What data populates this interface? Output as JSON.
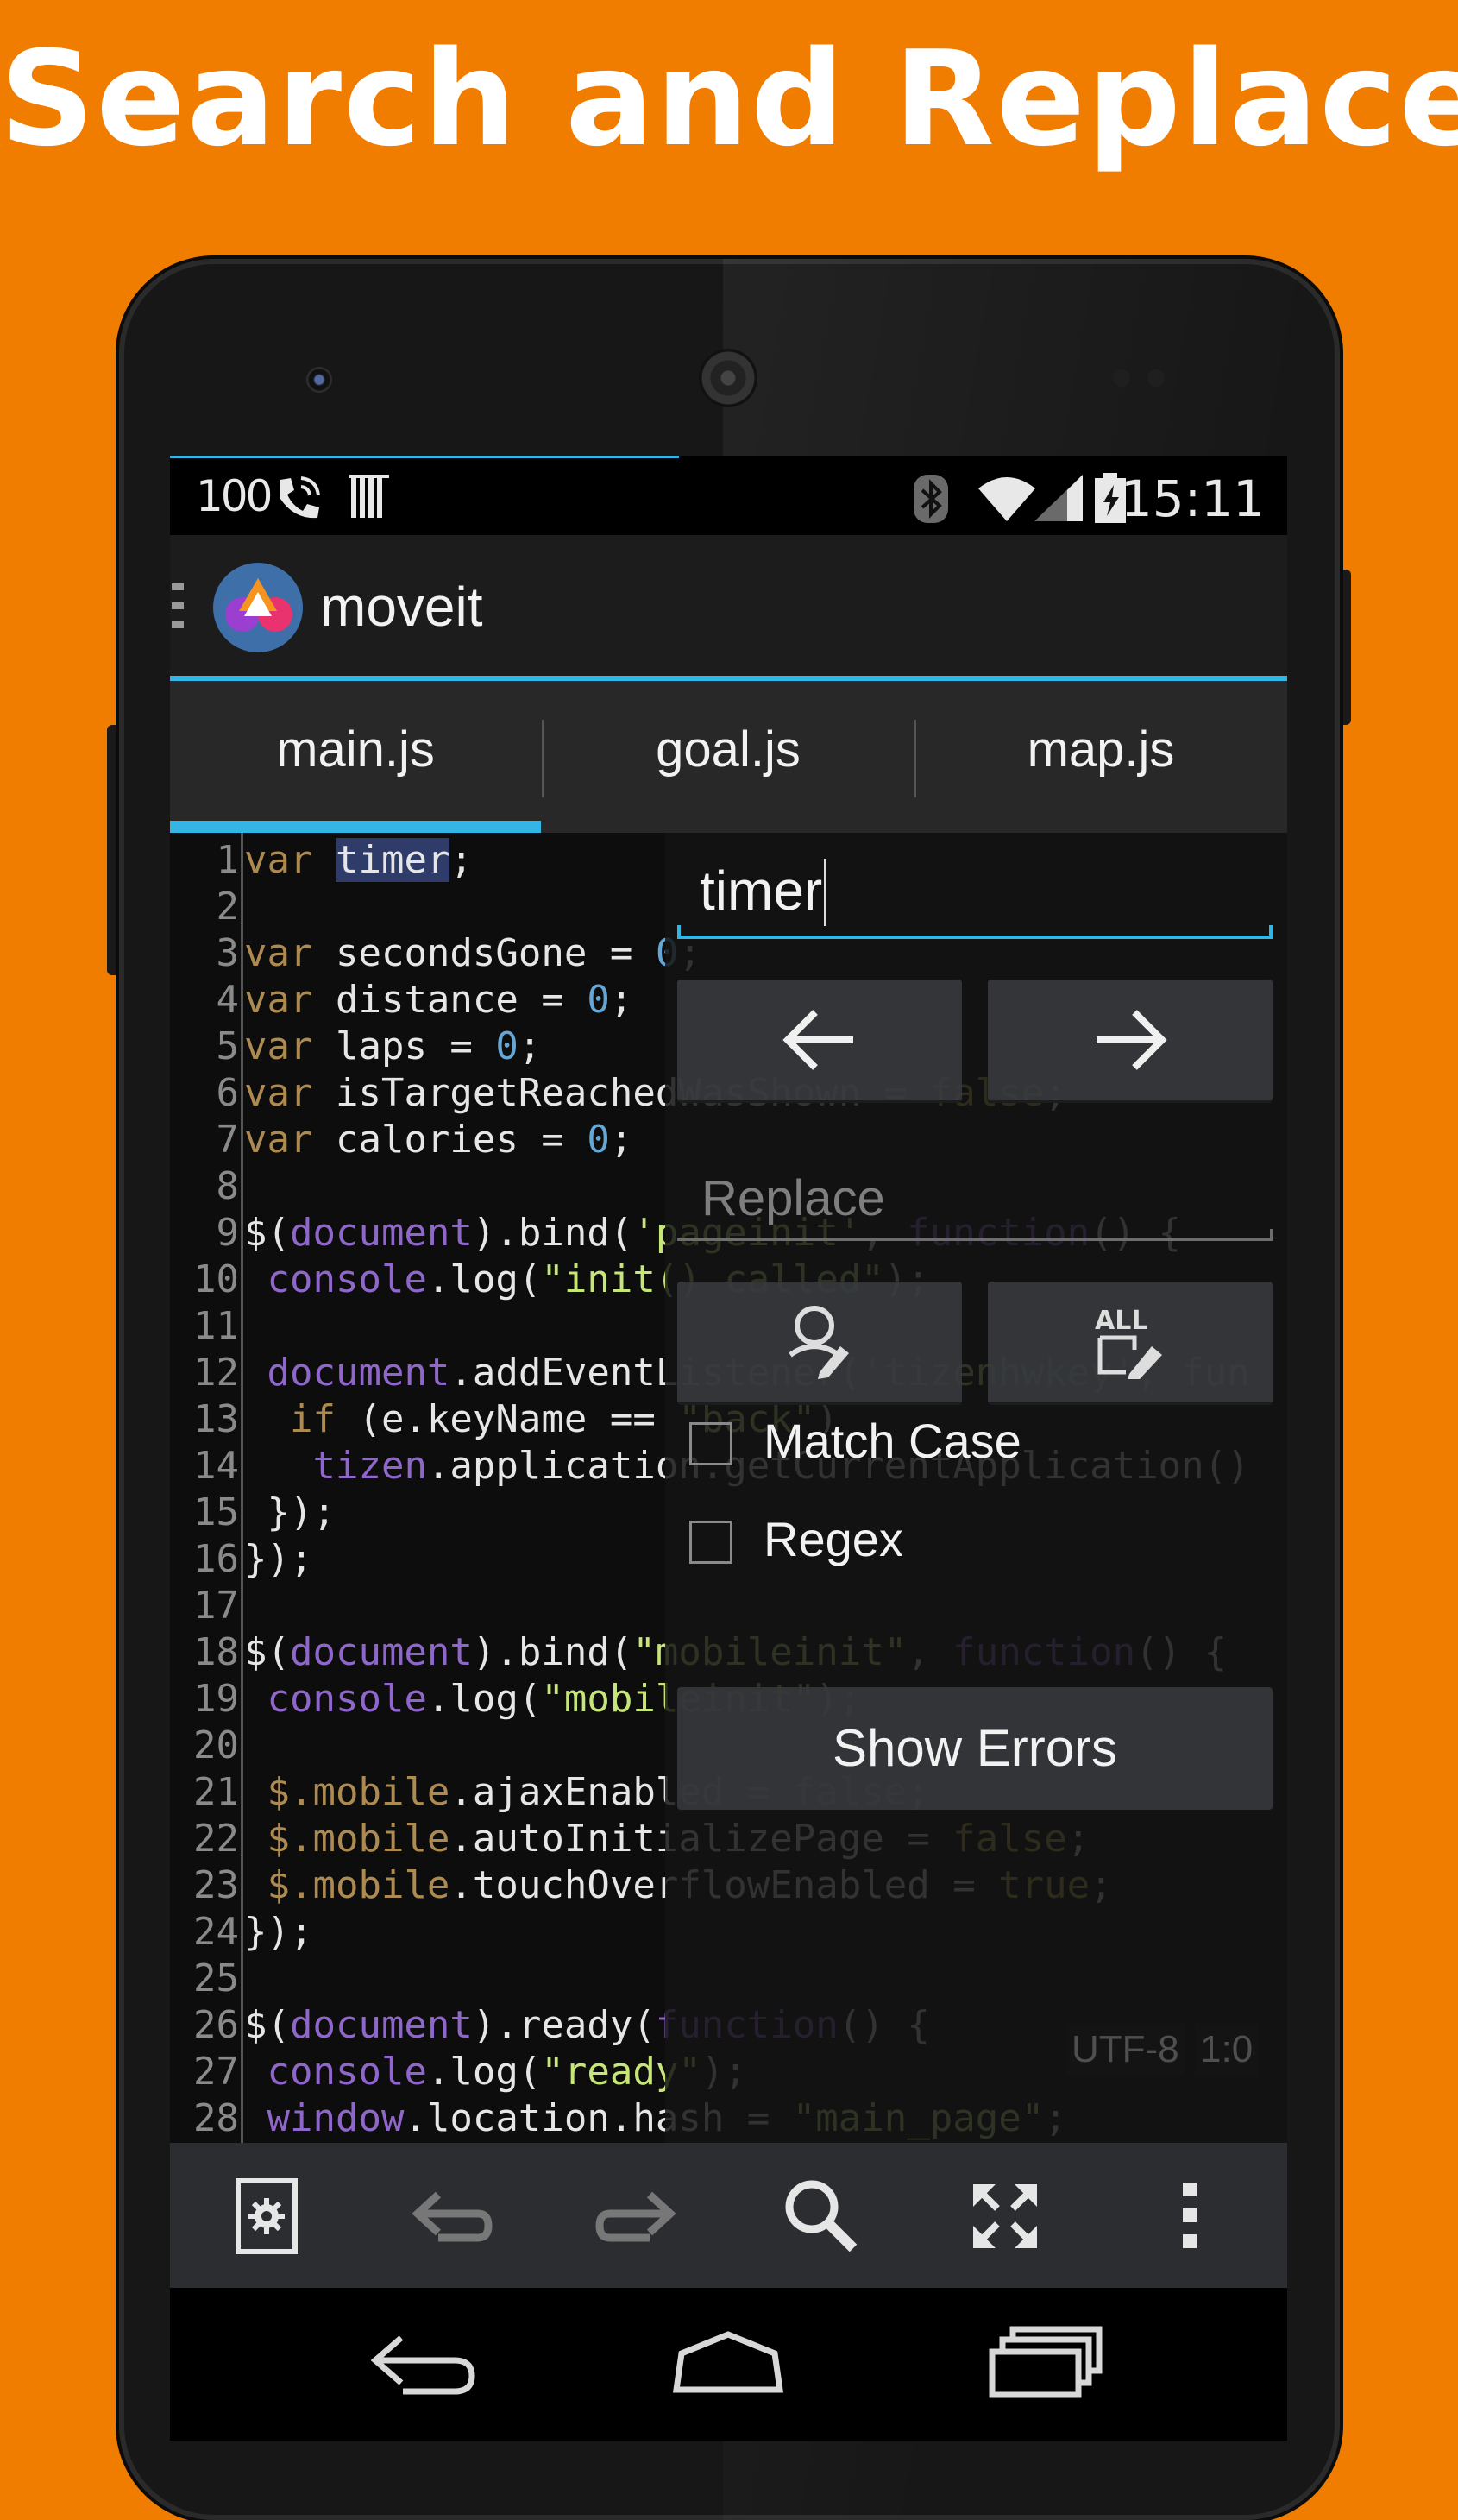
{
  "headline": "Search and Replace",
  "status_bar": {
    "battery_level_text": "100",
    "time": "15:11"
  },
  "app": {
    "title": "moveit",
    "logo_colors": [
      "#f7941e",
      "#9b3fd1",
      "#e8336e"
    ]
  },
  "tabs": [
    {
      "label": "main.js",
      "active": true
    },
    {
      "label": "goal.js",
      "active": false
    },
    {
      "label": "map.js",
      "active": false
    }
  ],
  "editor": {
    "line_numbers": [
      "1",
      "2",
      "3",
      "4",
      "5",
      "6",
      "7",
      "8",
      "9",
      "10",
      "11",
      "12",
      "13",
      "14",
      "15",
      "16",
      "17",
      "18",
      "19",
      "20",
      "21",
      "22",
      "23",
      "24",
      "25",
      "26",
      "27",
      "28"
    ],
    "lines": [
      "var timer;",
      "",
      "var secondsGone = 0;",
      "var distance = 0;",
      "var laps = 0;",
      "var isTargetReachedWasShown = false;",
      "var calories = 0;",
      "",
      "$(document).bind('pageinit', function() {",
      " console.log(\"init() called\");",
      "",
      " document.addEventListener('tizenhwkey', fun",
      "  if (e.keyName == \"back\")",
      "   tizen.application.getCurrentApplication()",
      " });",
      "});",
      "",
      "$(document).bind(\"mobileinit\", function() {",
      " console.log(\"mobileinit\");",
      "",
      " $.mobile.ajaxEnabled = false;",
      " $.mobile.autoInitializePage = false;",
      " $.mobile.touchOverflowEnabled = true;",
      "});",
      "",
      "$(document).ready(function() {",
      " console.log(\"ready\");",
      " window.location.hash = \"main_page\";"
    ],
    "highlighted_word": "timer",
    "colors": {
      "keyword": "#ad8a50",
      "function": "#8f66c9",
      "number": "#64a6d6",
      "string": "#c7e67a",
      "boolean": "#c0b64e",
      "selection": "#2f3c6a"
    }
  },
  "search_panel": {
    "search_value": "timer",
    "replace_placeholder": "Replace",
    "prev_icon": "arrow-left-icon",
    "next_icon": "arrow-right-icon",
    "replace_icon": "replace-one-icon",
    "replace_all_icon": "replace-all-icon",
    "replace_all_icon_text": "ALL",
    "match_case_label": "Match Case",
    "match_case_checked": false,
    "regex_label": "Regex",
    "regex_checked": false,
    "show_errors_label": "Show Errors"
  },
  "status_info": {
    "encoding": "UTF-8",
    "cursor": "1:0"
  },
  "toolbar": {
    "icons": [
      "settings-icon",
      "undo-icon",
      "redo-icon",
      "search-icon",
      "fullscreen-icon",
      "overflow-menu-icon"
    ]
  },
  "navigation": {
    "icons": [
      "back-icon",
      "home-icon",
      "recents-icon"
    ]
  },
  "accent_color": "#33b5e5",
  "background_color": "#f07d00"
}
